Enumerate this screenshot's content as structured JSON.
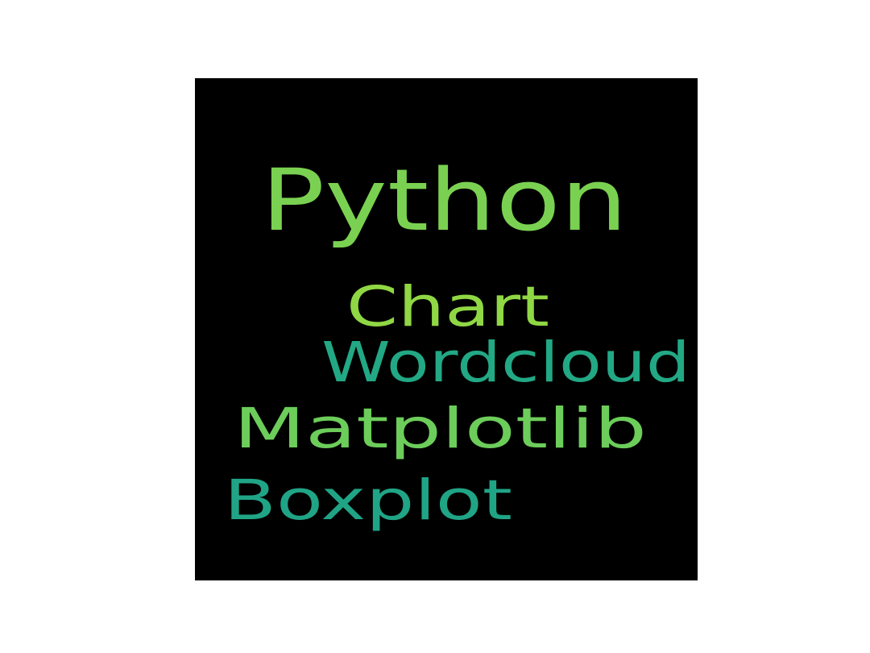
{
  "chart_data": {
    "type": "wordcloud",
    "background_color": "#000000",
    "words": [
      {
        "text": "Python",
        "weight": 1.0,
        "color": "#7ad151"
      },
      {
        "text": "Chart",
        "weight": 0.65,
        "color": "#8fd744"
      },
      {
        "text": "Wordcloud",
        "weight": 0.65,
        "color": "#22a884"
      },
      {
        "text": "Matplotlib",
        "weight": 0.65,
        "color": "#6ccd5a"
      },
      {
        "text": "Boxplot",
        "weight": 0.65,
        "color": "#20a486"
      }
    ]
  }
}
